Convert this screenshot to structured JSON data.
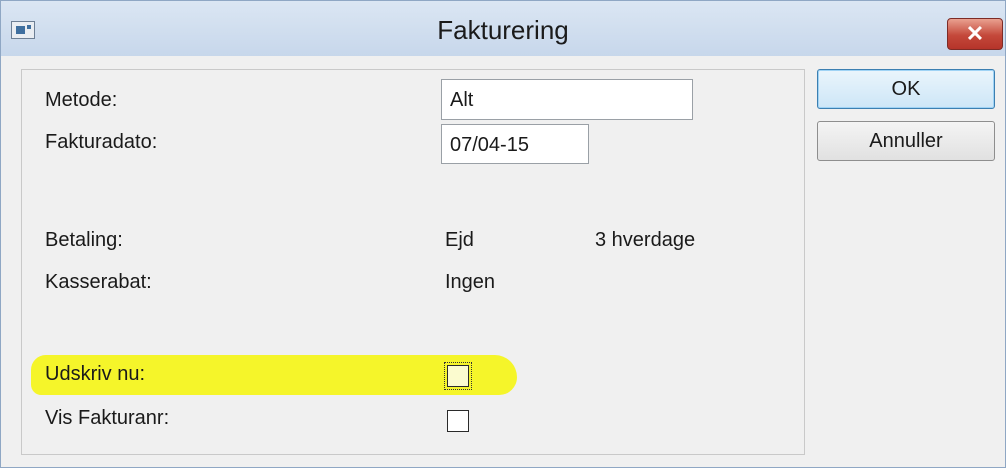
{
  "window": {
    "title": "Fakturering",
    "close_glyph": "✕",
    "app_icon": "window-icon"
  },
  "form": {
    "metode_label": "Metode:",
    "metode_value": "Alt",
    "fakturadato_label": "Fakturadato:",
    "fakturadato_value": "07/04-15",
    "betaling_label": "Betaling:",
    "betaling_value": "Ejd",
    "betaling_terms": "3 hverdage",
    "kasserabat_label": "Kasserabat:",
    "kasserabat_value": "Ingen",
    "udskriv_label": "Udskriv nu:",
    "udskriv_checked": false,
    "vis_label": "Vis Fakturanr:",
    "vis_checked": false,
    "highlight_color": "#f5f52a"
  },
  "buttons": {
    "ok": "OK",
    "cancel": "Annuller"
  }
}
